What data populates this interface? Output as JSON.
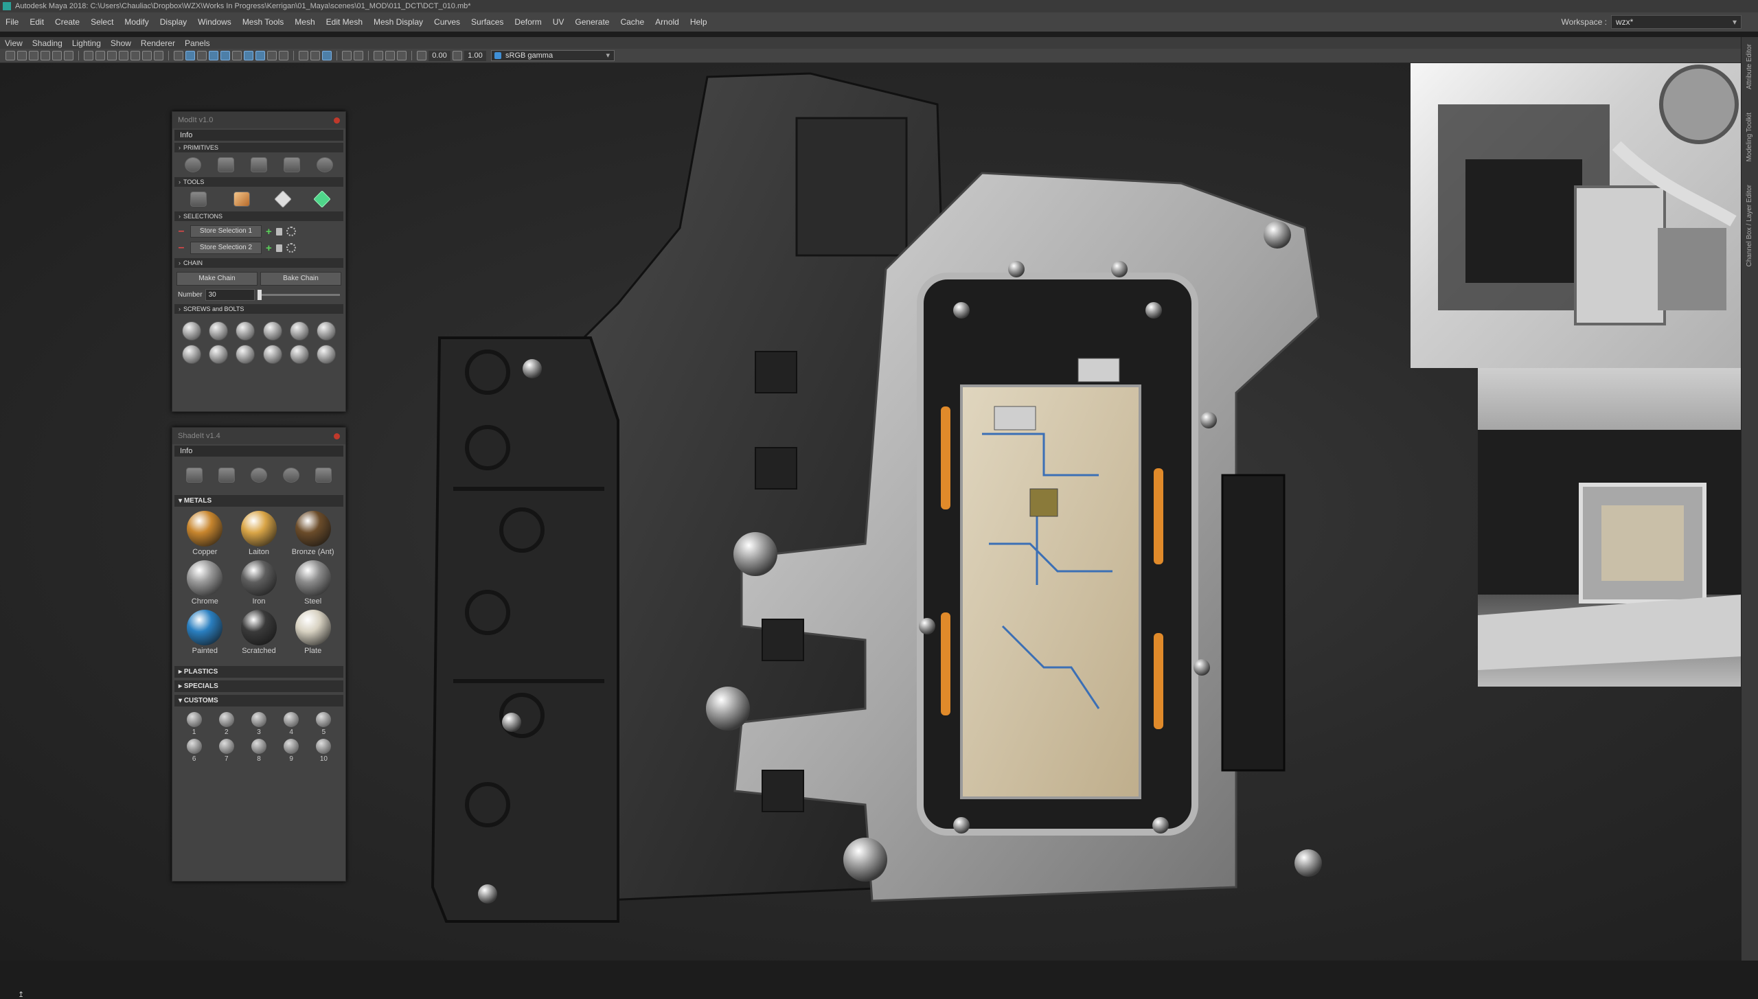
{
  "window": {
    "title": "Autodesk Maya 2018: C:\\Users\\Chauliac\\Dropbox\\WZX\\Works In Progress\\Kerrigan\\01_Maya\\scenes\\01_MOD\\011_DCT\\DCT_010.mb*"
  },
  "menubar": [
    "File",
    "Edit",
    "Create",
    "Select",
    "Modify",
    "Display",
    "Windows",
    "Mesh Tools",
    "Mesh",
    "Edit Mesh",
    "Mesh Display",
    "Curves",
    "Surfaces",
    "Deform",
    "UV",
    "Generate",
    "Cache",
    "Arnold",
    "Help"
  ],
  "workspace": {
    "label": "Workspace :",
    "value": "wzx*"
  },
  "viewport_menu": [
    "View",
    "Shading",
    "Lighting",
    "Show",
    "Renderer",
    "Panels"
  ],
  "viewport_toolbar": {
    "value1": "0.00",
    "value2": "1.00",
    "color_space": "sRGB gamma"
  },
  "right_tabs": [
    "Attribute Editor",
    "Modeling Toolkit",
    "Channel Box / Layer Editor"
  ],
  "modit": {
    "title": "ModIt v1.0",
    "info": "Info",
    "primitives_label": "PRIMITIVES",
    "tools_label": "TOOLS",
    "selections_label": "SELECTIONS",
    "store1": "Store Selection 1",
    "store2": "Store Selection 2",
    "chain_label": "CHAIN",
    "make_chain": "Make Chain",
    "bake_chain": "Bake Chain",
    "number_label": "Number",
    "number_value": "30",
    "screws_label": "SCREWS and BOLTS"
  },
  "shadeit": {
    "title": "ShadeIt v1.4",
    "info": "Info",
    "metals_label": "METALS",
    "metals": [
      {
        "name": "Copper",
        "color": "#c8862e"
      },
      {
        "name": "Laiton",
        "color": "#d9a547"
      },
      {
        "name": "Bronze (Ant)",
        "color": "#6b4c2a"
      },
      {
        "name": "Chrome",
        "color": "#9a9a9a"
      },
      {
        "name": "Iron",
        "color": "#5e5e5e"
      },
      {
        "name": "Steel",
        "color": "#8c8c8c"
      },
      {
        "name": "Painted",
        "color": "#2a7fc0"
      },
      {
        "name": "Scratched",
        "color": "#3a3a3a"
      },
      {
        "name": "Plate",
        "color": "#d8d2c2"
      }
    ],
    "plastics_label": "PLASTICS",
    "specials_label": "SPECIALS",
    "customs_label": "CUSTOMS",
    "customs": [
      "1",
      "2",
      "3",
      "4",
      "5",
      "6",
      "7",
      "8",
      "9",
      "10"
    ]
  }
}
